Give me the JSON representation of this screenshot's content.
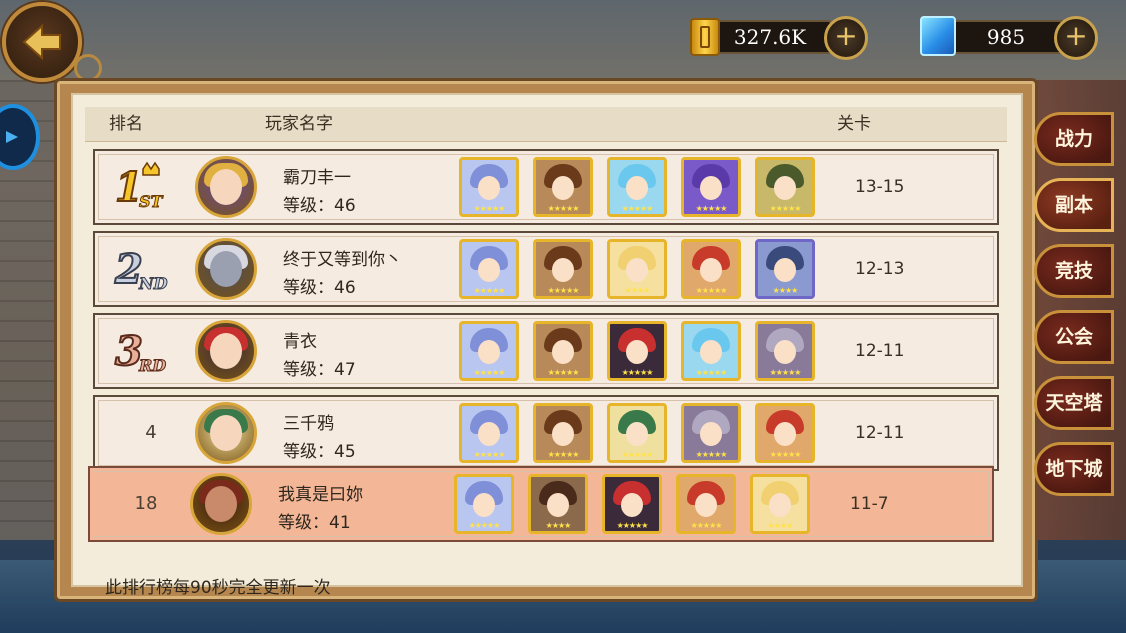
{
  "currency": {
    "gold_value": "327.6K",
    "gem_value": "985",
    "plus_symbol": "+"
  },
  "leaderboard": {
    "headers": {
      "rank": "排名",
      "player_name": "玩家名字",
      "stage": "关卡"
    },
    "rows": [
      {
        "rank": "1",
        "rank_badge": "1ST",
        "name": "霸刀丰一",
        "level": "等级：46",
        "stage": "13-15",
        "self": false,
        "avatar": {
          "hair": "#e0b040",
          "face": "#f6d7bd",
          "bg": "#6a4a9a"
        },
        "heroes": [
          {
            "hair": "#7f8fd8",
            "bg": "#b9c6f0",
            "frame": "gold",
            "stars": "★★★★★"
          },
          {
            "hair": "#6a3a1a",
            "bg": "#b88a5a",
            "frame": "gold",
            "stars": "★★★★★"
          },
          {
            "hair": "#6ac8ef",
            "bg": "#9ad8f0",
            "frame": "gold",
            "stars": "★★★★★"
          },
          {
            "hair": "#5a3aa8",
            "bg": "#7a5ac8",
            "frame": "gold",
            "stars": "★★★★★"
          },
          {
            "hair": "#4a5a2a",
            "bg": "#c8b86a",
            "frame": "gold",
            "stars": "★★★★★"
          }
        ]
      },
      {
        "rank": "2",
        "rank_badge": "2ND",
        "name": "终于又等到你丶",
        "level": "等级：46",
        "stage": "12-13",
        "self": false,
        "avatar": {
          "hair": "#d8d8e0",
          "face": "#9aa0b0",
          "bg": "#4a4a5a"
        },
        "heroes": [
          {
            "hair": "#7f8fd8",
            "bg": "#b9c6f0",
            "frame": "gold",
            "stars": "★★★★★"
          },
          {
            "hair": "#6a3a1a",
            "bg": "#b88a5a",
            "frame": "gold",
            "stars": "★★★★★"
          },
          {
            "hair": "#f0d070",
            "bg": "#f6e0a0",
            "frame": "gold",
            "stars": "★★★★"
          },
          {
            "hair": "#c83a2a",
            "bg": "#e0a86a",
            "frame": "gold",
            "stars": "★★★★★"
          },
          {
            "hair": "#3a4a7a",
            "bg": "#8a9ad0",
            "frame": "purple",
            "stars": "★★★★"
          }
        ]
      },
      {
        "rank": "3",
        "rank_badge": "3RD",
        "name": "青衣",
        "level": "等级：47",
        "stage": "12-11",
        "self": false,
        "avatar": {
          "hair": "#c83030",
          "face": "#f6d7bd",
          "bg": "#3a2a3a"
        },
        "heroes": [
          {
            "hair": "#7f8fd8",
            "bg": "#b9c6f0",
            "frame": "gold",
            "stars": "★★★★★"
          },
          {
            "hair": "#6a3a1a",
            "bg": "#b88a5a",
            "frame": "gold",
            "stars": "★★★★★"
          },
          {
            "hair": "#c83030",
            "bg": "#3a2a3a",
            "frame": "gold",
            "stars": "★★★★★"
          },
          {
            "hair": "#6ac8ef",
            "bg": "#9ad8f0",
            "frame": "gold",
            "stars": "★★★★★"
          },
          {
            "hair": "#b0a8c0",
            "bg": "#8a7a9a",
            "frame": "gold",
            "stars": "★★★★★"
          }
        ]
      },
      {
        "rank": "4",
        "rank_badge": "",
        "name": "三千鸦",
        "level": "等级：45",
        "stage": "12-11",
        "self": false,
        "avatar": {
          "hair": "#3a7a4a",
          "face": "#f6d7bd",
          "bg": "#f0e0a0"
        },
        "heroes": [
          {
            "hair": "#7f8fd8",
            "bg": "#b9c6f0",
            "frame": "gold",
            "stars": "★★★★★"
          },
          {
            "hair": "#6a3a1a",
            "bg": "#b88a5a",
            "frame": "gold",
            "stars": "★★★★★"
          },
          {
            "hair": "#3a7a4a",
            "bg": "#f0e0a0",
            "frame": "gold",
            "stars": "★★★★★"
          },
          {
            "hair": "#b0a8c0",
            "bg": "#8a7a9a",
            "frame": "gold",
            "stars": "★★★★★"
          },
          {
            "hair": "#c83a2a",
            "bg": "#e0a86a",
            "frame": "gold",
            "stars": "★★★★★"
          }
        ]
      }
    ],
    "self_row": {
      "rank": "18",
      "name": "我真是曰妳 ",
      "level": "等级：41",
      "stage": "11-7",
      "avatar": {
        "hair": "#7a2a1a",
        "face": "#c88a6a",
        "bg": "#3a1a10"
      },
      "heroes": [
        {
          "hair": "#7f8fd8",
          "bg": "#b9c6f0",
          "frame": "gold",
          "stars": "★★★★★"
        },
        {
          "hair": "#4a2a1a",
          "bg": "#8a6a4a",
          "frame": "gold",
          "stars": "★★★★"
        },
        {
          "hair": "#c83030",
          "bg": "#3a2a3a",
          "frame": "gold",
          "stars": "★★★★★"
        },
        {
          "hair": "#c83a2a",
          "bg": "#e0a86a",
          "frame": "gold",
          "stars": "★★★★★"
        },
        {
          "hair": "#f0d070",
          "bg": "#f6e0a0",
          "frame": "gold",
          "stars": "★★★★"
        }
      ]
    },
    "footer_note": "此排行榜每90秒完全更新一次"
  },
  "side_tabs": [
    {
      "label": "战力",
      "active": false
    },
    {
      "label": "副本",
      "active": true
    },
    {
      "label": "竞技",
      "active": false
    },
    {
      "label": "公会",
      "active": false
    },
    {
      "label": "天空塔",
      "active": false
    },
    {
      "label": "地下城",
      "active": false
    }
  ]
}
